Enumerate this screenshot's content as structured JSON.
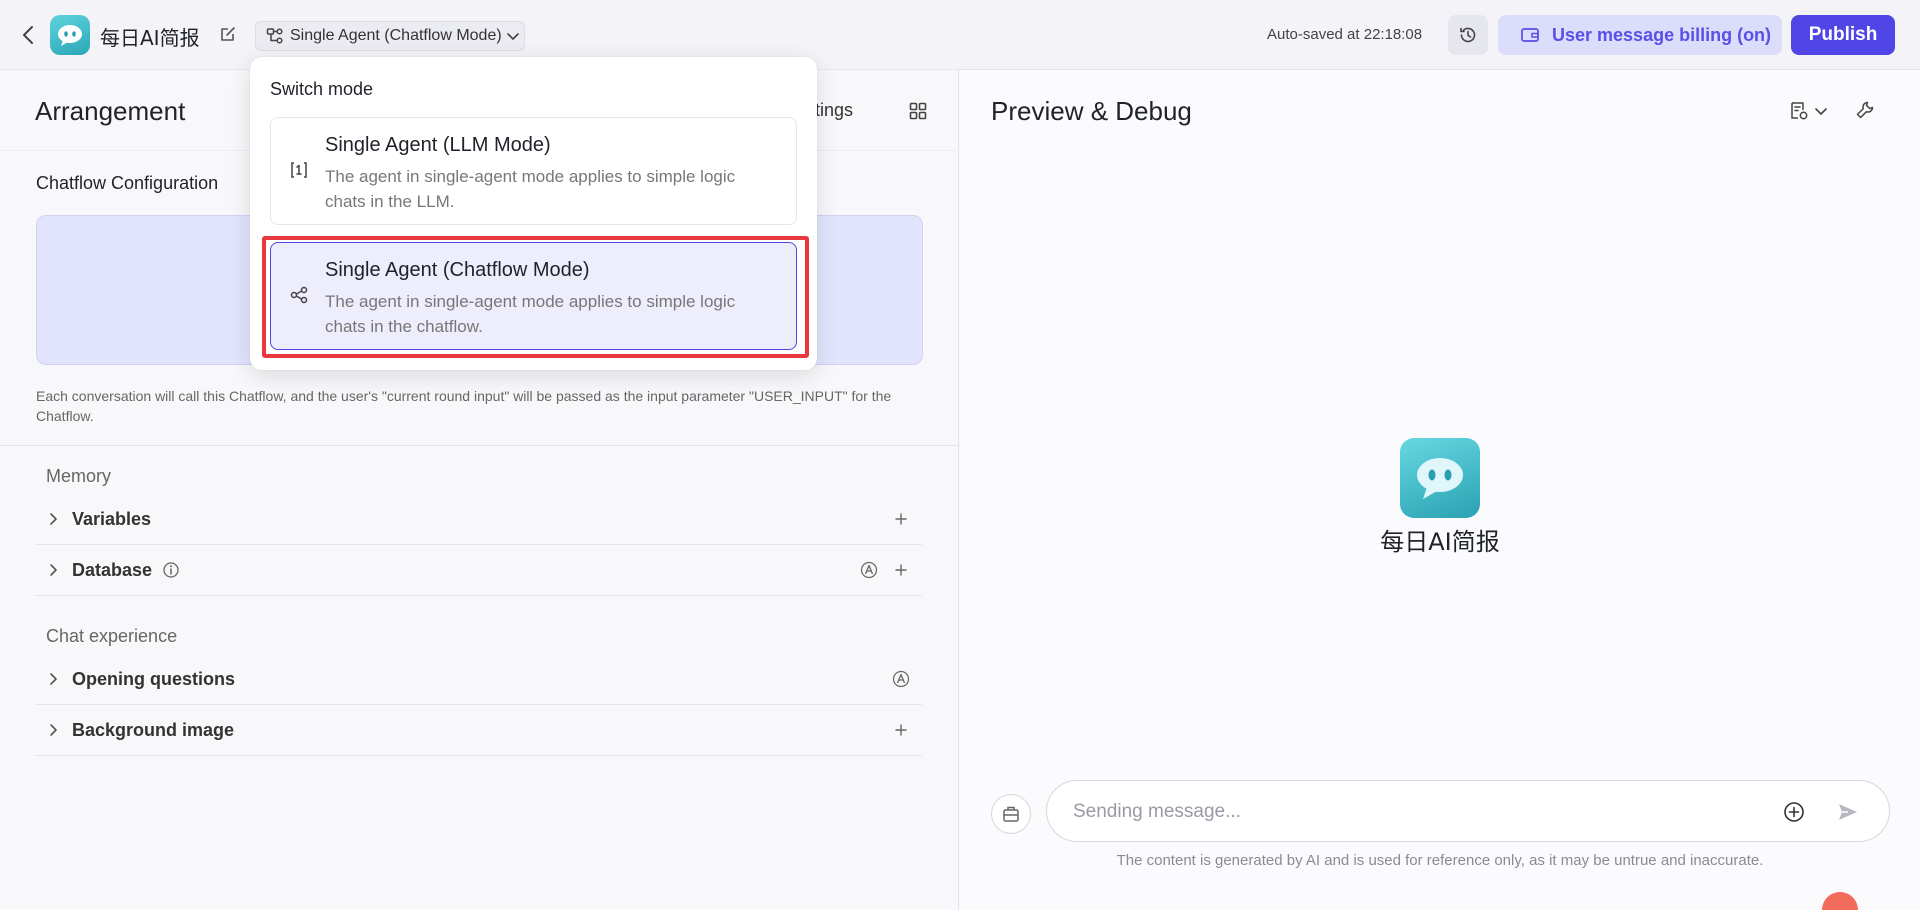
{
  "header": {
    "app_name": "每日AI简报",
    "mode_label": "Single Agent (Chatflow Mode)",
    "autosave": "Auto-saved at 22:18:08",
    "billing_label": "User message billing (on)",
    "publish_label": "Publish"
  },
  "left": {
    "title": "Arrangement",
    "settings_label": "ttings",
    "config_title": "Chatflow Configuration",
    "config_note": "Each conversation will call this Chatflow, and the user's \"current round input\" will be passed as the input parameter \"USER_INPUT\" for the Chatflow.",
    "memory_label": "Memory",
    "memory_items": [
      {
        "label": "Variables"
      },
      {
        "label": "Database"
      }
    ],
    "chat_label": "Chat experience",
    "chat_items": [
      {
        "label": "Opening questions"
      },
      {
        "label": "Background image"
      }
    ]
  },
  "right": {
    "title": "Preview & Debug",
    "bot_name": "每日AI简报",
    "input_placeholder": "Sending message...",
    "disclaimer": "The content is generated by AI and is used for reference only, as it may be untrue and inaccurate."
  },
  "dropdown": {
    "title": "Switch mode",
    "options": [
      {
        "name": "Single Agent (LLM Mode)",
        "desc": "The agent in single-agent mode applies to simple logic chats in the LLM."
      },
      {
        "name": "Single Agent (Chatflow Mode)",
        "desc": "The agent in single-agent mode applies to simple logic chats in the chatflow."
      }
    ]
  },
  "colors": {
    "accent": "#4f46e5",
    "highlight": "#e8383d",
    "avatar": "#2aa6b6"
  }
}
